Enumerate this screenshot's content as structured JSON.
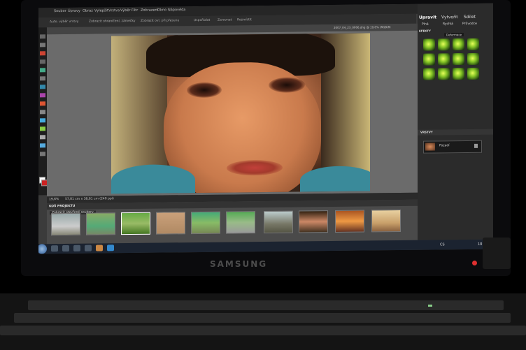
{
  "brand": "SAMSUNG",
  "app": {
    "menu": [
      "Soubor",
      "Úpravy",
      "Obraz",
      "Vylepšit",
      "Vrstva",
      "Výběr",
      "Filtr",
      "Zobrazení",
      "Okno",
      "Nápověda"
    ],
    "options": [
      "Auto. výběr vrstvy",
      "Zobrazit ohraničení, zámečky",
      "Zobrazit ovl. při přesunu",
      "Uspořádat",
      "Zarovnat",
      "Rozmístit"
    ],
    "tab_label": "2007_04_23_0006.dng @ 19,6% (RGB/8)",
    "zoom": "19,6%",
    "dimensions": "57,81 cm x 38,61 cm (240 ppi)",
    "project_bin_title": "KOŠ PROJEKTU",
    "project_bin_dropdown": "Zobrazit otevřené soubory",
    "right_tabs": [
      "Upravit",
      "Vytvořit",
      "Sdílet"
    ],
    "sub_tabs": [
      "Plná",
      "Rychlá",
      "Průvodce"
    ],
    "effects_title": "EFEKTY",
    "effects_category": "Deformace",
    "layers_title": "VRSTVY",
    "layer_name": "Pozadí",
    "taskbar_lang": "CS",
    "clock": "18:06"
  },
  "colors": {
    "screen_bg": "#3b3b3b",
    "panel": "#2b2b2b",
    "canvas": "#6b6b6b",
    "taskbar": "#1b2330",
    "accent_red": "#e03030"
  }
}
